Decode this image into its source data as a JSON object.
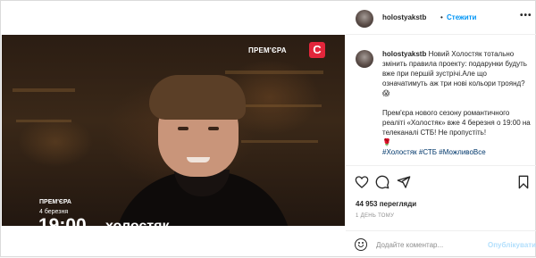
{
  "post": {
    "username": "holostyakstb",
    "follow_label": "Стежити",
    "dot": "•",
    "more": "•••"
  },
  "video": {
    "premiere_top": "ПРЕМ'ЄРА",
    "channel_logo": "С",
    "premiere_bottom": "ПРЕМ'ЄРА",
    "date": "4 березня",
    "time": "19:00",
    "show_title": "холостяк",
    "sound_icon": "volume-icon"
  },
  "caption": {
    "username": "holostyakstb",
    "text1": "Новий Холостяк тотально змінить правила проекту: подарунки будуть вже при першій зустрічі.Але що означатимуть аж три нові кольори троянд?",
    "text1_emoji": "😱",
    "rose_emoji": "🌹",
    "text2": "Прем'єра нового сезону романтичного реаліті «Холостяк» вже 4 березня о 19:00 на телеканалі СТБ! Не пропустіть!",
    "hashtags": [
      "#Холостяк",
      "#СТБ",
      "#МожливоВсе"
    ]
  },
  "actions": {
    "views": "44 953 перегляди",
    "time_ago": "1 ДЕНЬ ТОМУ"
  },
  "comment": {
    "placeholder": "Додайте коментар...",
    "publish_label": "Опублікувати"
  }
}
